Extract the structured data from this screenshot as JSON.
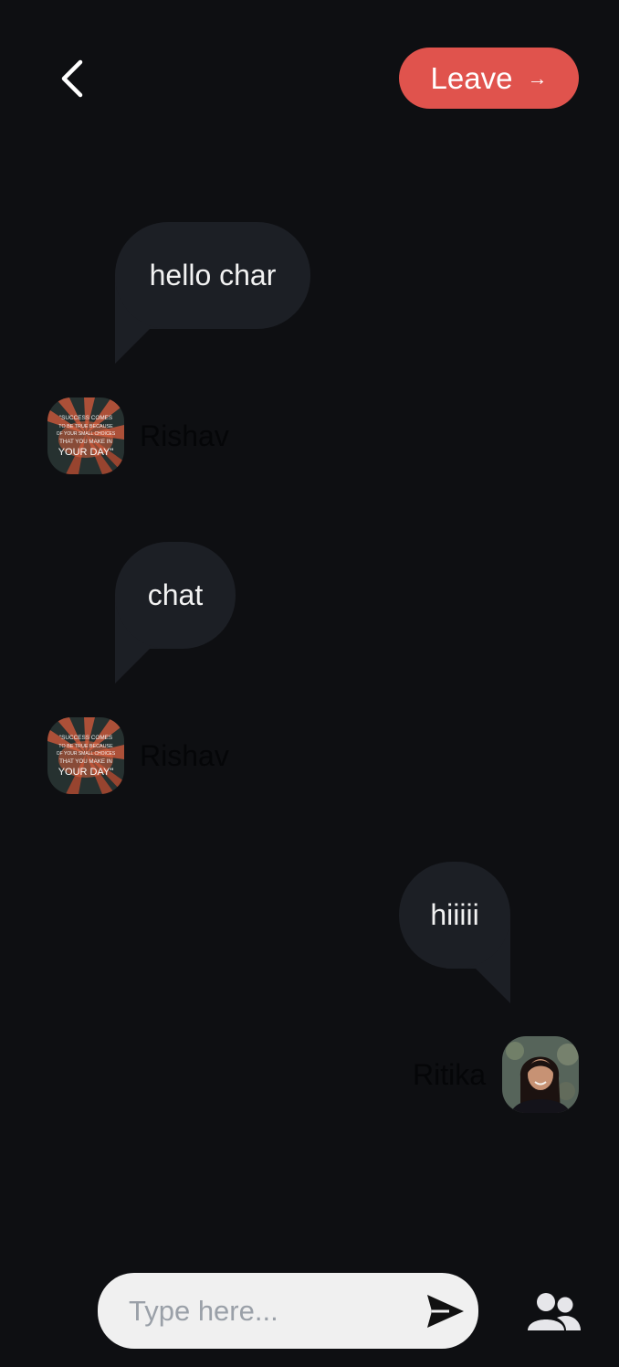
{
  "header": {
    "back_icon": "chevron-left-icon",
    "leave_label": "Leave",
    "leave_icon": "arrow-right-icon",
    "leave_color": "#e0534d"
  },
  "messages": [
    {
      "text": "hello char",
      "sender": "Rishav",
      "side": "left",
      "avatar": "quote-image-avatar"
    },
    {
      "text": "chat",
      "sender": "Rishav",
      "side": "left",
      "avatar": "quote-image-avatar"
    },
    {
      "text": "hiiiii",
      "sender": "Ritika",
      "side": "right",
      "avatar": "photo-avatar"
    }
  ],
  "avatar_quote_lines": [
    "\"SUCCESS COMES",
    "TO BE TRUE BECAUSE",
    "OF YOUR SMALL CHOICES",
    "THAT YOU MAKE IN",
    "YOUR DAY\""
  ],
  "composer": {
    "placeholder": "Type here...",
    "send_icon": "send-icon",
    "participants_icon": "users-icon"
  }
}
